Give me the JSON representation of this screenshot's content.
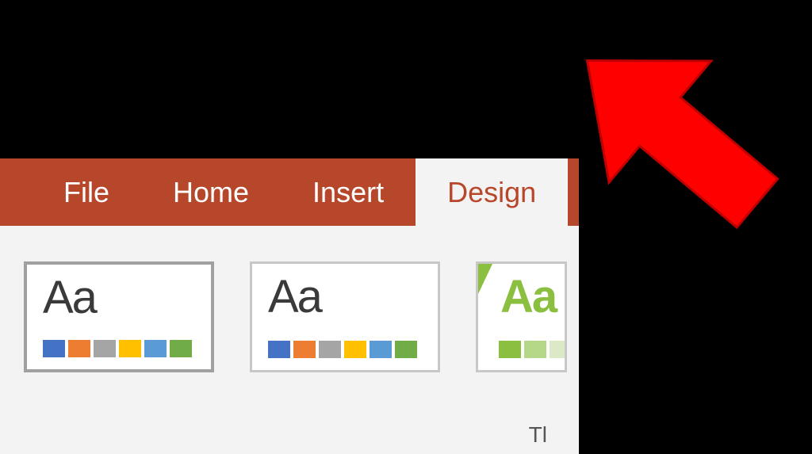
{
  "tabs": {
    "file": "File",
    "home": "Home",
    "insert": "Insert",
    "design": "Design"
  },
  "themes": {
    "theme1_aa": "Aa",
    "theme2_aa": "Aa",
    "theme3_aa": "Aa",
    "swatches_default": [
      "#4472c4",
      "#ed7d31",
      "#a5a5a5",
      "#ffc000",
      "#5b9bd5",
      "#70ad47"
    ],
    "swatches_green": [
      "#8bbf3f",
      "#b4d788",
      "#dce9c6",
      "#6da829"
    ]
  },
  "group_label_visible": "Tl",
  "colors": {
    "ribbon_bg": "#b7472a",
    "content_bg": "#f3f3f3"
  }
}
